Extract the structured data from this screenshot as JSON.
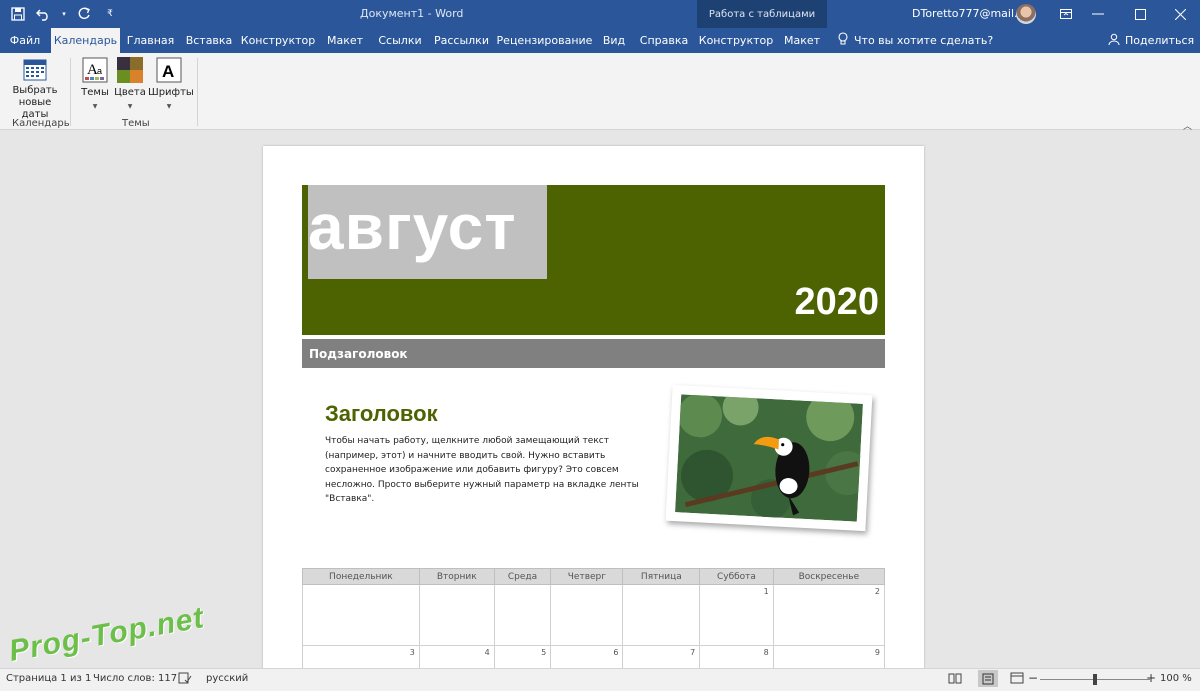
{
  "titlebar": {
    "document_title": "Документ1  -  Word",
    "context_group": "Работа с таблицами",
    "user_email": "DToretto777@mail.ru"
  },
  "tabs": [
    {
      "label": "Файл"
    },
    {
      "label": "Календарь"
    },
    {
      "label": "Главная"
    },
    {
      "label": "Вставка"
    },
    {
      "label": "Конструктор"
    },
    {
      "label": "Макет"
    },
    {
      "label": "Ссылки"
    },
    {
      "label": "Рассылки"
    },
    {
      "label": "Рецензирование"
    },
    {
      "label": "Вид"
    },
    {
      "label": "Справка"
    },
    {
      "label": "Конструктор"
    },
    {
      "label": "Макет"
    }
  ],
  "tell_me": "Что вы хотите сделать?",
  "share": "Поделиться",
  "ribbon": {
    "select_dates_line1": "Выбрать",
    "select_dates_line2": "новые даты",
    "group_calendar": "Календарь",
    "themes": "Темы",
    "colors": "Цвета",
    "fonts": "Шрифты",
    "group_themes": "Темы"
  },
  "document": {
    "month": "август",
    "year": "2020",
    "subheading": "Подзаголовок",
    "heading": "Заголовок",
    "body": "Чтобы начать работу, щелкните любой замещающий текст (например, этот) и начните вводить свой. Нужно вставить сохраненное изображение или добавить фигуру? Это совсем несложно. Просто выберите нужный параметр на вкладке ленты \"Вставка\".",
    "calendar": {
      "days": [
        "Понедельник",
        "Вторник",
        "Среда",
        "Четверг",
        "Пятница",
        "Суббота",
        "Воскресенье"
      ],
      "week1": [
        "",
        "",
        "",
        "",
        "",
        "1",
        "2"
      ],
      "week2": [
        "3",
        "4",
        "5",
        "6",
        "7",
        "8",
        "9"
      ]
    }
  },
  "status": {
    "page": "Страница 1 из 1",
    "words": "Число слов: 117",
    "language": "русский",
    "zoom": "100 %"
  },
  "watermark": "Prog-Top.net",
  "colors": {
    "word_blue": "#2b579a",
    "banner_green": "#4d6200",
    "subheading_gray": "#808080"
  }
}
